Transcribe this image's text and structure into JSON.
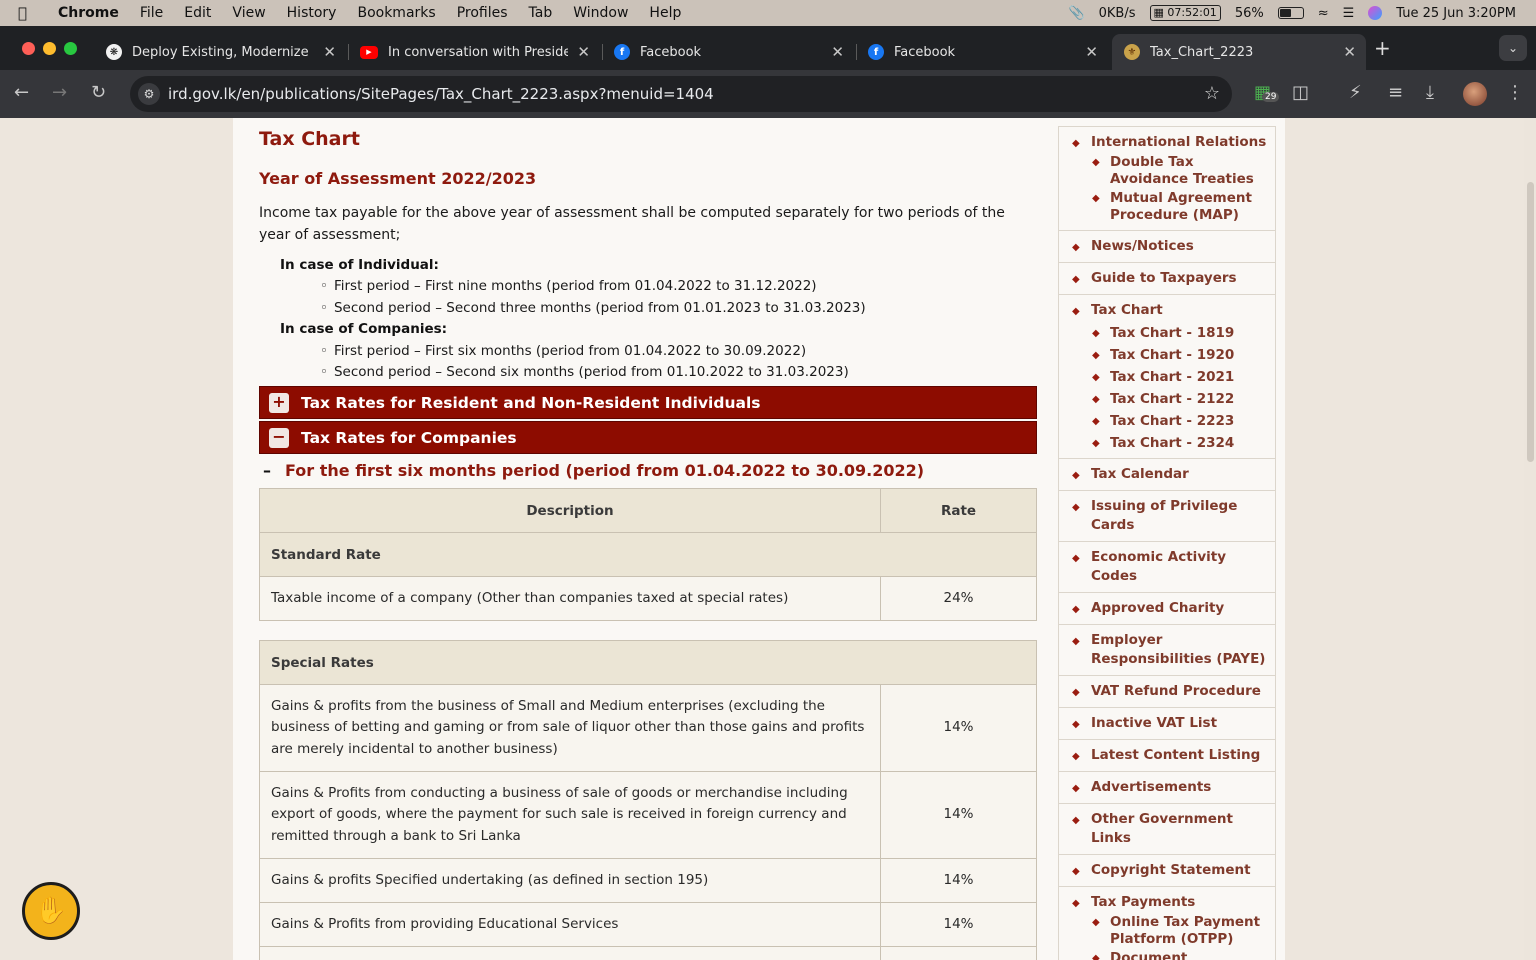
{
  "menubar": {
    "app": "Chrome",
    "items": [
      "File",
      "Edit",
      "View",
      "History",
      "Bookmarks",
      "Profiles",
      "Tab",
      "Window",
      "Help"
    ],
    "net_speed": "0KB/s",
    "cpu_time": "07:52:01",
    "battery": "56%",
    "battery_level": 0.56,
    "datetime": "Tue 25 Jun  3:20PM"
  },
  "tabs": [
    {
      "title": "Deploy Existing, Modernize w",
      "icon": "openai-icon"
    },
    {
      "title": "In conversation with Presiden",
      "icon": "youtube-icon"
    },
    {
      "title": "Facebook",
      "icon": "facebook-icon"
    },
    {
      "title": "Facebook",
      "icon": "facebook-icon"
    },
    {
      "title": "Tax_Chart_2223",
      "icon": "ird-crest-icon"
    }
  ],
  "toolbar": {
    "url": "ird.gov.lk/en/publications/SitePages/Tax_Chart_2223.aspx?menuid=1404",
    "extension_badge": "29"
  },
  "page": {
    "title": "Tax Chart",
    "subtitle": "Year of Assessment 2022/2023",
    "intro": "Income tax payable for the above year of assessment shall be computed separately for two periods of the year of assessment;",
    "individual_title": "In case of Individual:",
    "individual": [
      "First period – First nine months (period from 01.04.2022 to 31.12.2022)",
      "Second period – Second three months (period from 01.01.2023 to 31.03.2023)"
    ],
    "companies_title": "In case of Companies:",
    "companies": [
      "First period – First six months (period from 01.04.2022 to 30.09.2022)",
      "Second period – Second six months (period from 01.10.2022 to 31.03.2023)"
    ],
    "accordion_individuals": "Tax Rates for Resident and Non-Resident Individuals",
    "accordion_companies": "Tax Rates for Companies",
    "period_heading": "For the first six months period (period from 01.04.2022 to 30.09.2022)",
    "table": {
      "headers": [
        "Description",
        "Rate"
      ],
      "standard_title": "Standard Rate",
      "standard_row": {
        "desc": "Taxable income of a company (Other than companies taxed at special rates)",
        "rate": "24%"
      },
      "special_title": "Special Rates",
      "special_rows": [
        {
          "desc": "Gains & profits from the business of Small and Medium enterprises (excluding the business of betting and gaming or from sale of liquor other than those gains and profits are merely incidental to another business)",
          "rate": "14%"
        },
        {
          "desc": "Gains & Profits from conducting a business of sale of goods or merchandise including export of goods, where the payment for such sale is received in foreign currency and remitted through a bank to Sri Lanka",
          "rate": "14%"
        },
        {
          "desc": "Gains & profits Specified undertaking (as defined in section 195)",
          "rate": "14%"
        },
        {
          "desc": "Gains & Profits from providing Educational Services",
          "rate": "14%"
        }
      ]
    }
  },
  "sidebar": {
    "international": "International Relations",
    "dtaa": "Double Tax Avoidance Treaties",
    "map": "Mutual Agreement Procedure (MAP)",
    "news": "News/Notices",
    "guide": "Guide to Taxpayers",
    "tax_chart": "Tax Chart",
    "charts": [
      "Tax Chart - 1819",
      "Tax Chart - 1920",
      "Tax Chart - 2021",
      "Tax Chart - 2122",
      "Tax Chart - 2223",
      "Tax Chart - 2324"
    ],
    "calendar": "Tax Calendar",
    "privilege": "Issuing of Privilege Cards",
    "economic": "Economic Activity Codes",
    "charity": "Approved Charity",
    "employer": "Employer Responsibilities (PAYE)",
    "vat_refund": "VAT Refund Procedure",
    "inactive_vat": "Inactive VAT List",
    "latest": "Latest Content Listing",
    "ads": "Advertisements",
    "other_links": "Other Government Links",
    "copyright": "Copyright Statement",
    "payments": "Tax Payments",
    "otpp": "Online Tax Payment Platform (OTPP)",
    "document": "Document"
  },
  "colors": {
    "accent": "#8d0c00",
    "heading": "#8e1a0e",
    "sidebar_link": "#7f3a2b",
    "widget": "#f3b31b"
  }
}
